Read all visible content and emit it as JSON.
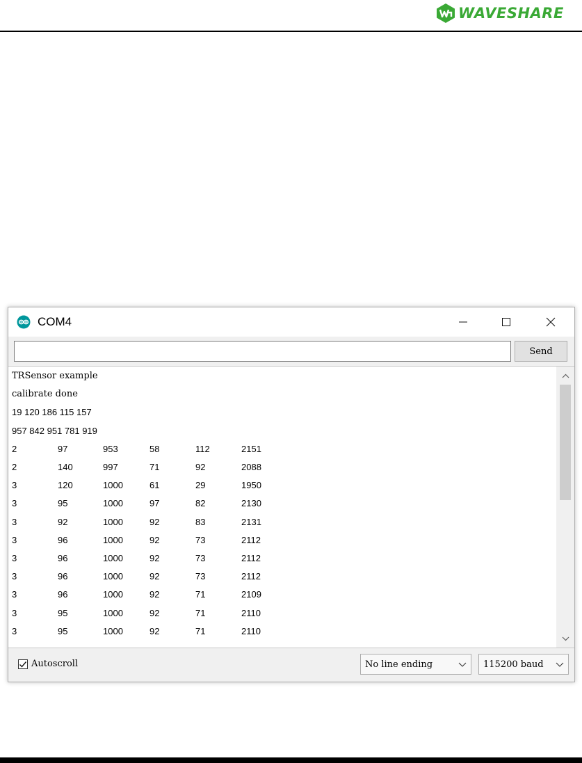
{
  "header": {
    "brand_text": "WAVESHARE",
    "brand_color": "#3aa935"
  },
  "window": {
    "title": "COM4",
    "app_icon": "arduino-icon",
    "controls": {
      "minimize": "—",
      "maximize": "☐",
      "close": "✕"
    }
  },
  "input_row": {
    "value": "",
    "send_label": "Send"
  },
  "output": {
    "text_lines": [
      "TRSensor example",
      "calibrate done",
      "19 120 186 115 157",
      "957 842 951 781 919"
    ],
    "rows": [
      [
        "2",
        "97",
        "953",
        "58",
        "112",
        "2151"
      ],
      [
        "2",
        "140",
        "997",
        "71",
        "92",
        "2088"
      ],
      [
        "3",
        "120",
        "1000",
        "61",
        "29",
        "1950"
      ],
      [
        "3",
        "95",
        "1000",
        "97",
        "82",
        "2130"
      ],
      [
        "3",
        "92",
        "1000",
        "92",
        "83",
        "2131"
      ],
      [
        "3",
        "96",
        "1000",
        "92",
        "73",
        "2112"
      ],
      [
        "3",
        "96",
        "1000",
        "92",
        "73",
        "2112"
      ],
      [
        "3",
        "96",
        "1000",
        "92",
        "73",
        "2112"
      ],
      [
        "3",
        "96",
        "1000",
        "92",
        "71",
        "2109"
      ],
      [
        "3",
        "95",
        "1000",
        "92",
        "71",
        "2110"
      ],
      [
        "3",
        "95",
        "1000",
        "92",
        "71",
        "2110"
      ]
    ]
  },
  "status": {
    "autoscroll_label": "Autoscroll",
    "autoscroll_checked": true,
    "line_ending": "No line ending",
    "baud": "115200 baud"
  }
}
